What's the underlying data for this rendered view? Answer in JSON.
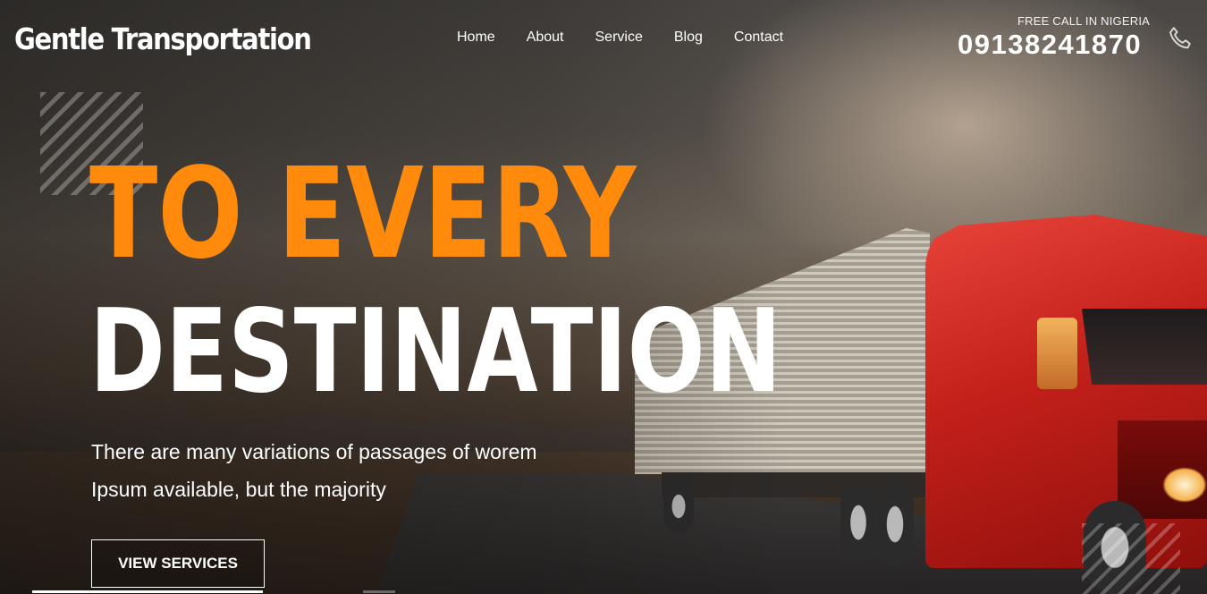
{
  "header": {
    "brand": "Gentle Transportation",
    "nav": [
      {
        "label": "Home"
      },
      {
        "label": "About"
      },
      {
        "label": "Service"
      },
      {
        "label": "Blog"
      },
      {
        "label": "Contact"
      }
    ],
    "call_label": "FREE CALL IN NIGERIA",
    "phone": "09138241870",
    "phone_icon": "phone-icon"
  },
  "hero": {
    "title_line1": "TO EVERY",
    "title_line2": "DESTINATION",
    "description_line1": "There are many variations of passages of worem",
    "description_line2": "Ipsum available, but the majority",
    "cta_label": "VIEW SERVICES"
  },
  "colors": {
    "accent": "#ff8a0c",
    "text": "#ffffff"
  }
}
